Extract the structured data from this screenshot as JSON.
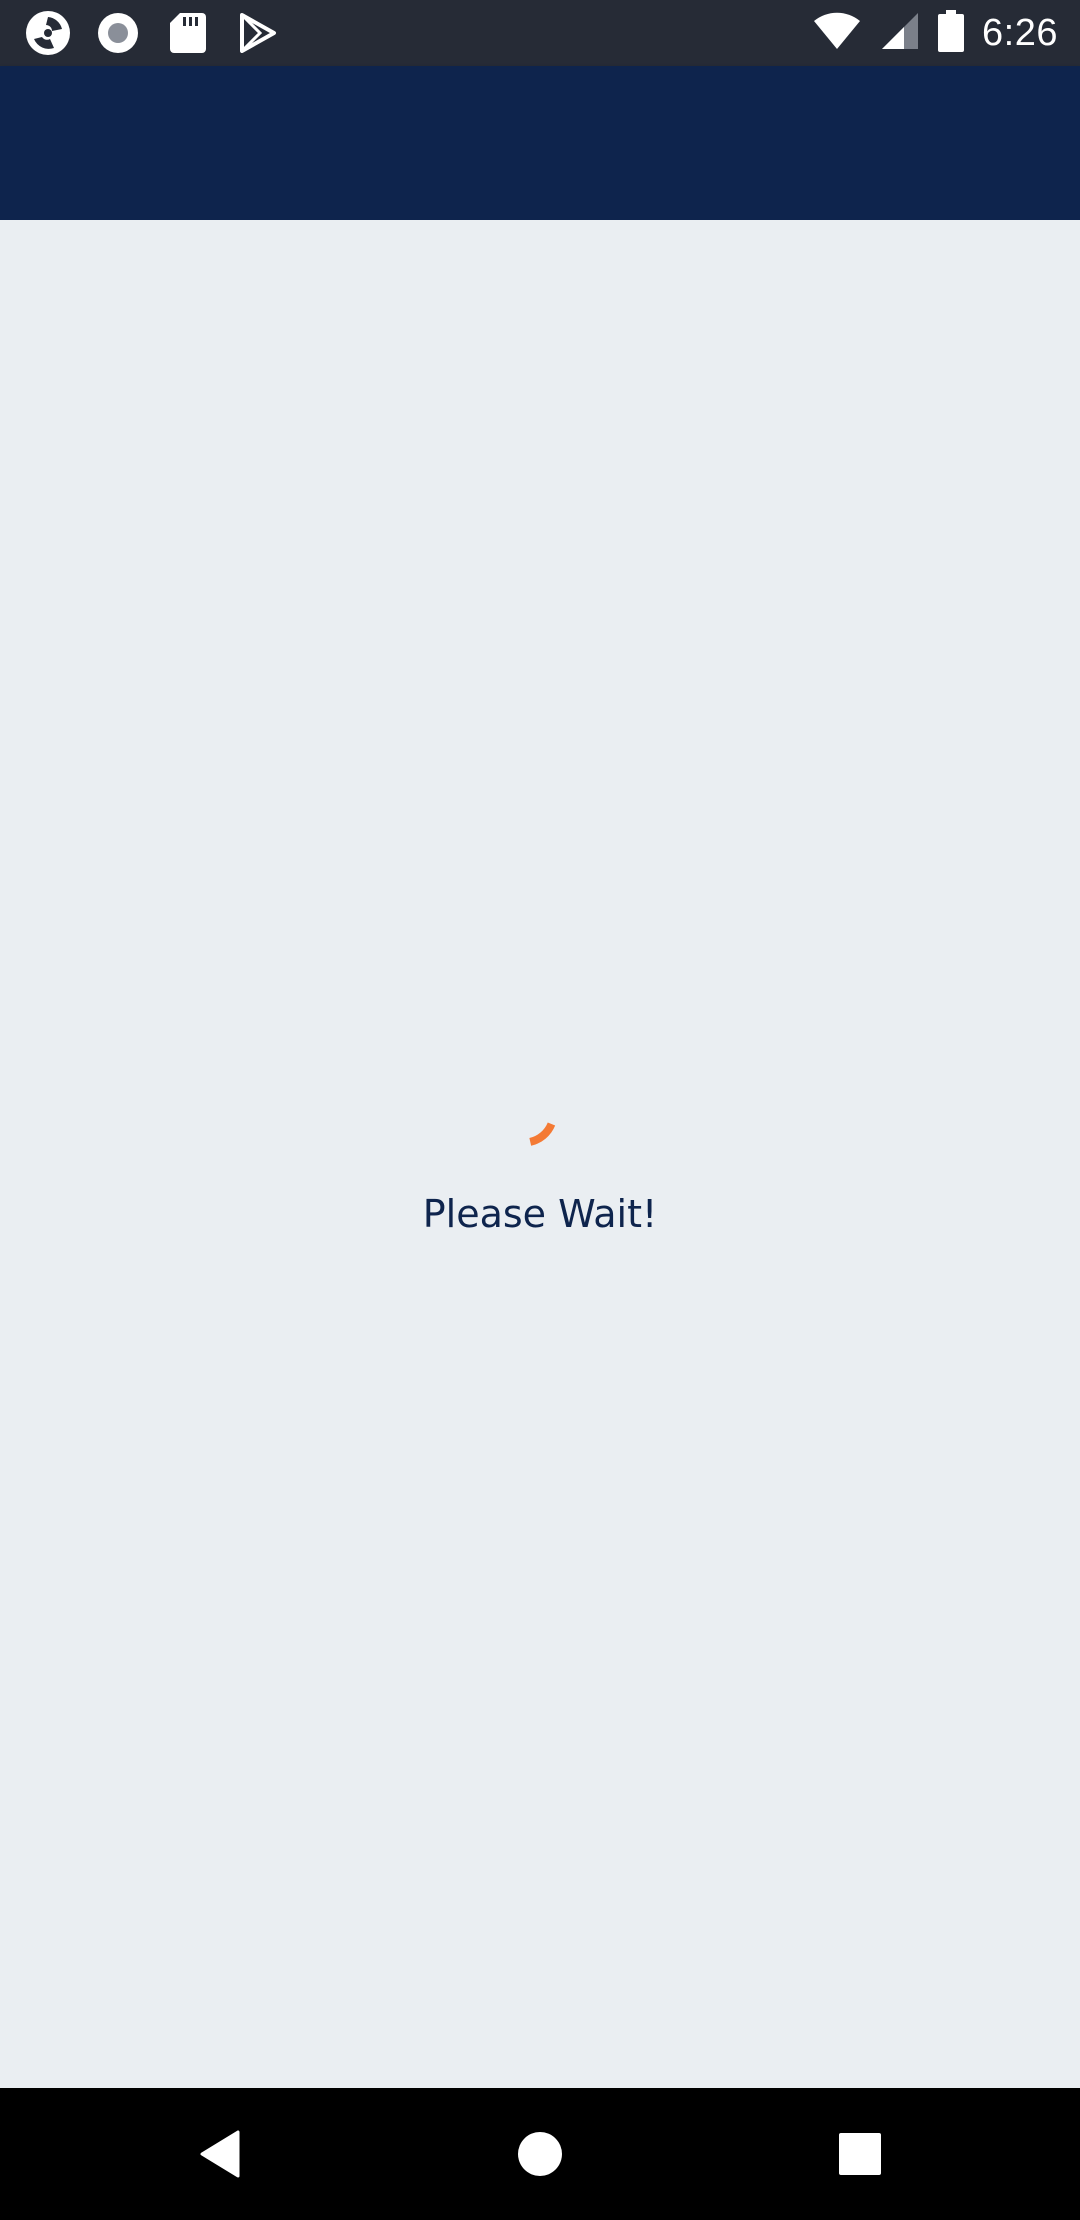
{
  "status_bar": {
    "time": "6:26",
    "left_icons": [
      "app-logo-icon",
      "record-icon",
      "sd-card-icon",
      "play-store-icon"
    ],
    "right_icons": [
      "wifi-icon",
      "cell-signal-icon",
      "battery-icon"
    ]
  },
  "app_bar": {
    "color": "#0e244d"
  },
  "loading": {
    "message": "Please Wait!",
    "spinner_color": "#f47a35"
  },
  "nav_bar": {
    "buttons": [
      "back-icon",
      "home-icon",
      "recents-icon"
    ]
  },
  "colors": {
    "background": "#eaeef2",
    "status_bar": "#262b36",
    "text": "#0e244d"
  }
}
